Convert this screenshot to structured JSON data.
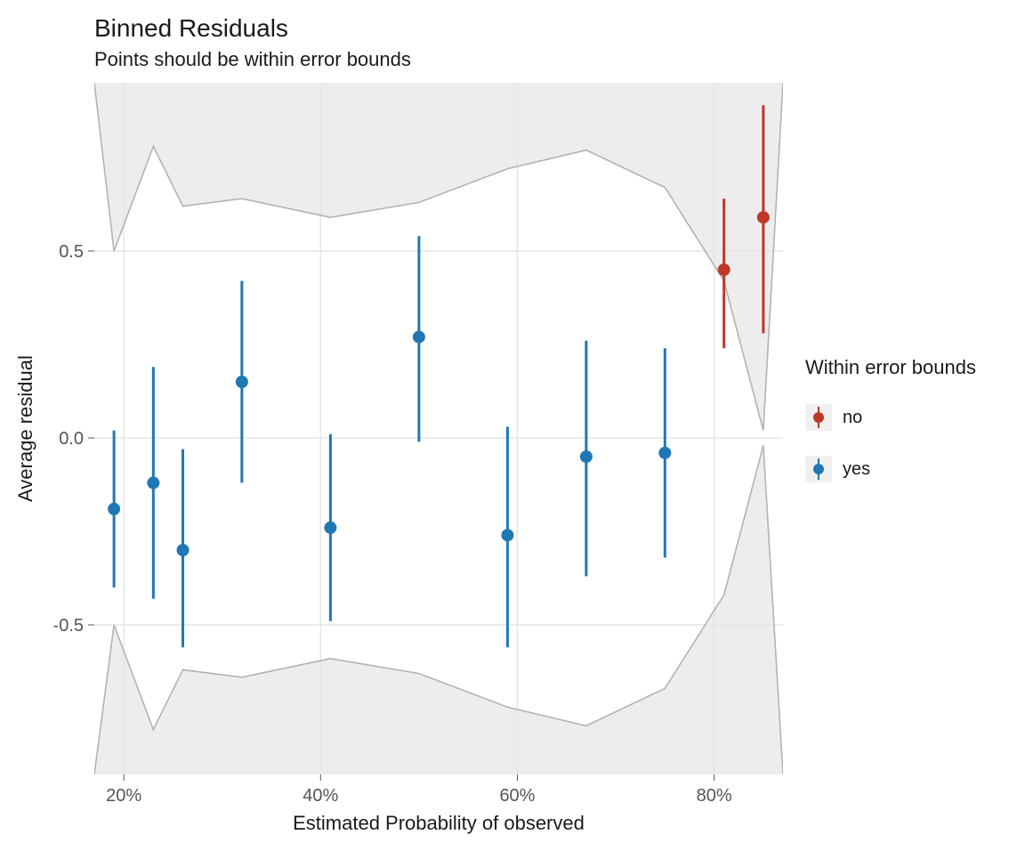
{
  "chart_data": {
    "type": "scatter",
    "title": "Binned Residuals",
    "subtitle": "Points should be within error bounds",
    "xlabel": "Estimated Probability of observed",
    "ylabel": "Average residual",
    "xlim": [
      17,
      87
    ],
    "ylim": [
      -0.9,
      0.95
    ],
    "x_ticks": [
      20,
      40,
      60,
      80
    ],
    "x_tick_labels": [
      "20%",
      "40%",
      "60%",
      "80%"
    ],
    "y_ticks": [
      -0.5,
      0.0,
      0.5
    ],
    "y_tick_labels": [
      "-0.5",
      "0.0",
      "0.5"
    ],
    "colors": {
      "no": "#c03728",
      "yes": "#1f78b4"
    },
    "legend": {
      "title": "Within error bounds",
      "items": [
        {
          "label": "no",
          "key": "no"
        },
        {
          "label": "yes",
          "key": "yes"
        }
      ]
    },
    "points": [
      {
        "x": 19,
        "y": -0.19,
        "lo": -0.4,
        "hi": 0.02,
        "group": "yes"
      },
      {
        "x": 23,
        "y": -0.12,
        "lo": -0.43,
        "hi": 0.19,
        "group": "yes"
      },
      {
        "x": 26,
        "y": -0.3,
        "lo": -0.56,
        "hi": -0.03,
        "group": "yes"
      },
      {
        "x": 32,
        "y": 0.15,
        "lo": -0.12,
        "hi": 0.42,
        "group": "yes"
      },
      {
        "x": 41,
        "y": -0.24,
        "lo": -0.49,
        "hi": 0.01,
        "group": "yes"
      },
      {
        "x": 50,
        "y": 0.27,
        "lo": -0.01,
        "hi": 0.54,
        "group": "yes"
      },
      {
        "x": 59,
        "y": -0.26,
        "lo": -0.56,
        "hi": 0.03,
        "group": "yes"
      },
      {
        "x": 67,
        "y": -0.05,
        "lo": -0.37,
        "hi": 0.26,
        "group": "yes"
      },
      {
        "x": 75,
        "y": -0.04,
        "lo": -0.32,
        "hi": 0.24,
        "group": "yes"
      },
      {
        "x": 81,
        "y": 0.45,
        "lo": 0.24,
        "hi": 0.64,
        "group": "no"
      },
      {
        "x": 85,
        "y": 0.59,
        "lo": 0.28,
        "hi": 0.89,
        "group": "no"
      }
    ],
    "error_bounds": {
      "x": [
        17,
        19,
        23,
        26,
        32,
        41,
        50,
        59,
        67,
        75,
        81,
        85,
        87
      ],
      "upper": [
        0.95,
        0.5,
        0.78,
        0.62,
        0.64,
        0.59,
        0.63,
        0.72,
        0.77,
        0.67,
        0.42,
        0.02,
        0.95
      ],
      "lower": [
        -0.9,
        -0.5,
        -0.78,
        -0.62,
        -0.64,
        -0.59,
        -0.63,
        -0.72,
        -0.77,
        -0.67,
        -0.42,
        -0.02,
        -0.9
      ]
    }
  }
}
